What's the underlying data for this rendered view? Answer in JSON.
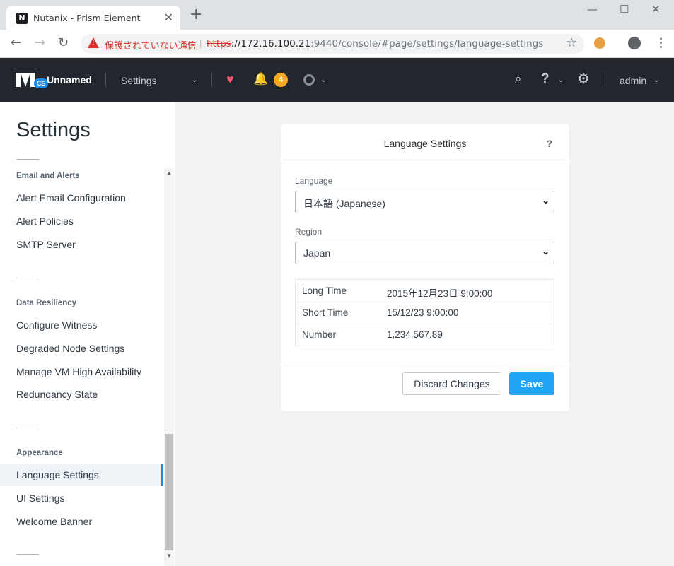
{
  "browser": {
    "tab_title": "Nutanix - Prism Element",
    "tab_favicon_letter": "N",
    "close_glyph": "✕",
    "new_tab_glyph": "+",
    "window_controls": {
      "minimize": "—",
      "maximize": "☐",
      "close": "✕"
    },
    "nav": {
      "back": "←",
      "forward": "→",
      "reload": "↻"
    },
    "security_label": "保護されていない通信",
    "url_scheme": "https",
    "url_host": "://172.16.100.21",
    "url_rest": ":9440/console/#page/settings/language-settings",
    "star_glyph": "☆",
    "menu_glyph": "⋮"
  },
  "header": {
    "logo_badge": "CE",
    "cluster_name": "Unnamed",
    "menu_label": "Settings",
    "alert_count": "4",
    "user": "admin",
    "icons": {
      "health": "health-heart-icon",
      "alerts": "bell-icon",
      "tasks": "tasks-circle-icon",
      "search": "search-icon",
      "help": "help-icon",
      "settings": "gear-icon"
    },
    "glyphs": {
      "caret": "⌄",
      "heart": "♥",
      "bell": "🔔",
      "search": "⌕",
      "help": "?",
      "gear": "⚙"
    }
  },
  "sidebar": {
    "title": "Settings",
    "groups": [
      {
        "name": "Email and Alerts",
        "items": [
          "Alert Email Configuration",
          "Alert Policies",
          "SMTP Server"
        ]
      },
      {
        "name": "Data Resiliency",
        "items": [
          "Configure Witness",
          "Degraded Node Settings",
          "Manage VM High Availability",
          "Redundancy State"
        ]
      },
      {
        "name": "Appearance",
        "items": [
          "Language Settings",
          "UI Settings",
          "Welcome Banner"
        ]
      }
    ],
    "active_item": "Language Settings"
  },
  "dialog": {
    "title": "Language Settings",
    "help": "?",
    "language_label": "Language",
    "language_value": "日本語 (Japanese)",
    "region_label": "Region",
    "region_value": "Japan",
    "formats": [
      {
        "key": "Long Time",
        "value": "2015年12月23日 9:00:00"
      },
      {
        "key": "Short Time",
        "value": "15/12/23 9:00:00"
      },
      {
        "key": "Number",
        "value": "1,234,567.89"
      }
    ],
    "discard_label": "Discard Changes",
    "save_label": "Save"
  },
  "colors": {
    "header_bg": "#22272e",
    "accent": "#22a5f7",
    "badge": "#f5a623",
    "health": "#f05a6e",
    "warning": "#d93025"
  }
}
